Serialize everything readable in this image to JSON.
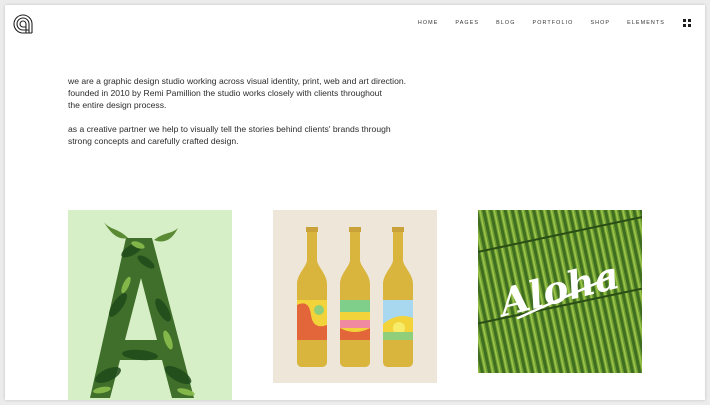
{
  "header": {
    "logo": "concentric-arc-logo-icon",
    "nav": [
      "HOME",
      "PAGES",
      "BLOG",
      "PORTFOLIO",
      "SHOP",
      "ELEMENTS"
    ],
    "menu_icon": "grid-menu-icon"
  },
  "intro": {
    "paragraph1": {
      "line1": "we are a graphic design studio working across visual identity, print, web and art direction.",
      "line2": "founded in 2010 by Remi Pamillion the studio works closely with clients throughout",
      "line3": "the entire design process."
    },
    "paragraph2": {
      "line1": "as a creative partner we help to visually tell the stories behind clients' brands through",
      "line2": "strong concepts and carefully crafted design."
    }
  },
  "portfolio": {
    "tiles": [
      {
        "artwork": "tropical-leaf-letter-a-image",
        "background": "#d7efc6"
      },
      {
        "artwork": "three-bottles-image",
        "background": "#efe6da"
      },
      {
        "artwork": "aloha-bamboo-image",
        "background": "#4a7a25",
        "lettering": "Aloha"
      }
    ]
  },
  "colors": {
    "text": "#2c2c2c",
    "page": "#ffffff"
  }
}
